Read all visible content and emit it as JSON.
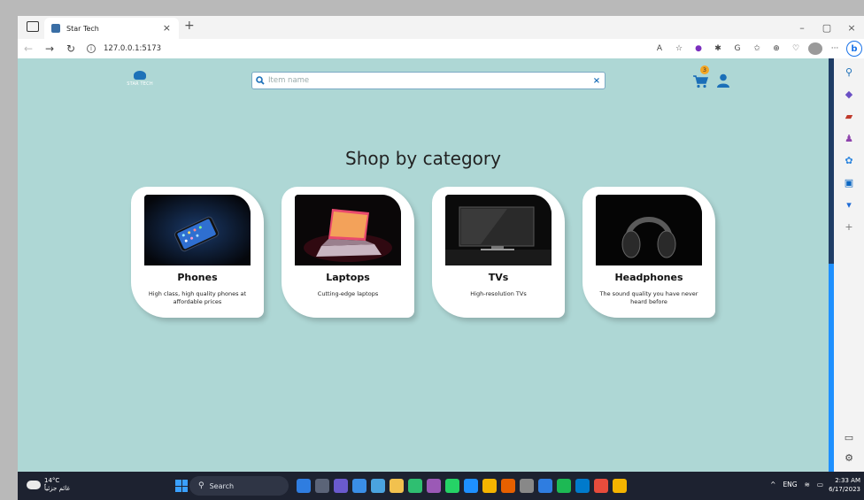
{
  "browser": {
    "tab_title": "Star Tech",
    "tab_close": "×",
    "new_tab": "+",
    "url": "127.0.0.1:5173",
    "read_aloud": "A",
    "window_controls": {
      "minimize": "–",
      "maximize": "▢",
      "close": "×"
    }
  },
  "app": {
    "logo_text": "STAR TECH",
    "search": {
      "placeholder": "Item name",
      "clear": "×"
    },
    "cart_count": "3",
    "heading": "Shop by category",
    "categories": [
      {
        "name": "Phones",
        "description": "High class, high quality phones at affordable prices",
        "icon": "phone-image"
      },
      {
        "name": "Laptops",
        "description": "Cutting-edge laptops",
        "icon": "laptop-image"
      },
      {
        "name": "TVs",
        "description": "High-resolution TVs",
        "icon": "tv-image"
      },
      {
        "name": "Headphones",
        "description": "The sound quality you have never heard before",
        "icon": "headphones-image"
      }
    ]
  },
  "taskbar": {
    "weather_temp": "14°C",
    "weather_desc": "غائم جزئياً",
    "search_label": "Search",
    "language": "ENG",
    "time": "2:33 AM",
    "date": "6/17/2023"
  },
  "colors": {
    "page_background": "#aed7d5",
    "accent": "#1b6fb8",
    "badge": "#f5a623"
  }
}
